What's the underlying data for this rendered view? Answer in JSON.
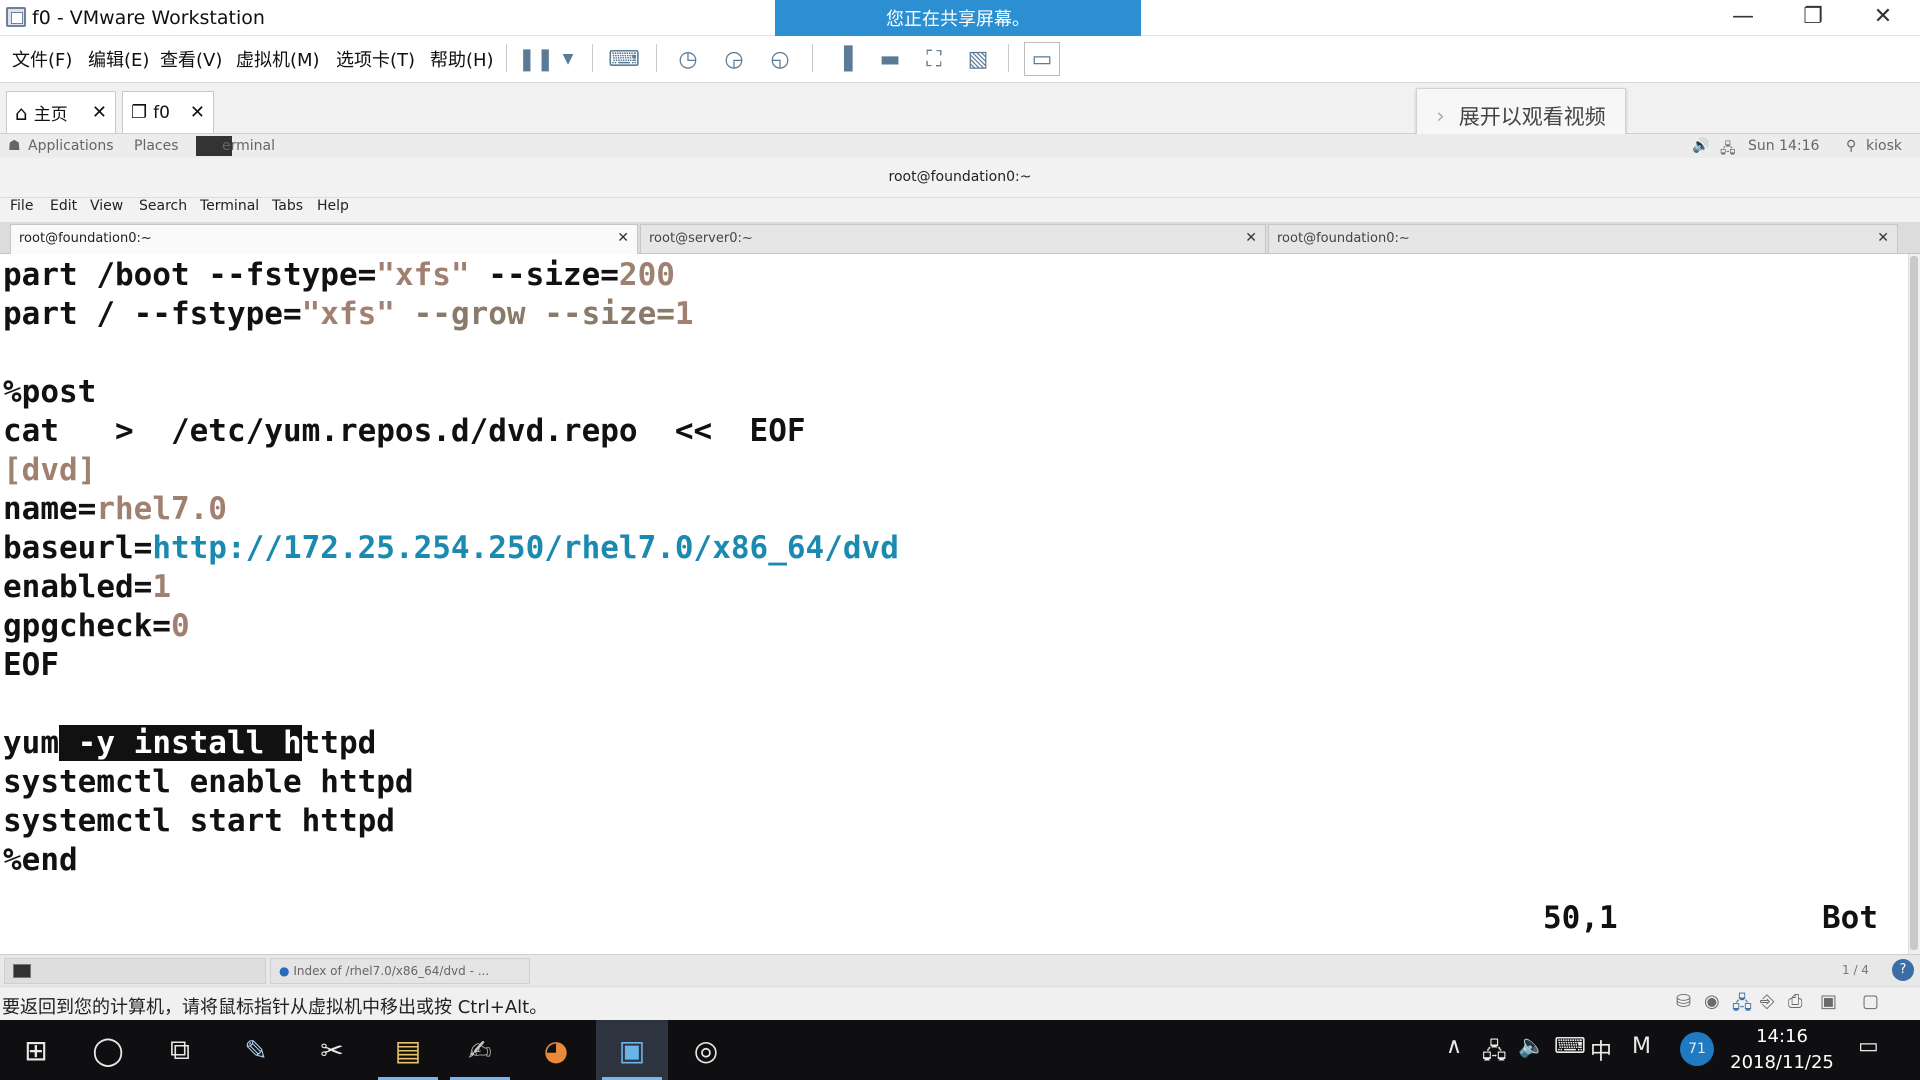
{
  "window": {
    "title": "f0 - VMware Workstation"
  },
  "share_banner": "您正在共享屏幕。",
  "menu": [
    "文件(F)",
    "编辑(E)",
    "查看(V)",
    "虚拟机(M)",
    "选项卡(T)",
    "帮助(H)"
  ],
  "toolbar_icons": [
    "pause-icon",
    "dropdown-icon",
    "send-keys-icon",
    "snapshot-icon",
    "revert-snapshot-icon",
    "snapshot-manager-icon",
    "sidebar-icon",
    "thumbnail-icon",
    "fullscreen-icon",
    "unity-icon",
    "console-icon"
  ],
  "vm_tabs": [
    {
      "label": "主页"
    },
    {
      "label": "f0"
    }
  ],
  "overlay": "展开以观看视频",
  "gnome": {
    "applications": "Applications",
    "places": "Places",
    "terminal_label": "erminal",
    "time": "Sun 14:16",
    "user": "kiosk"
  },
  "terminal": {
    "title": "root@foundation0:~",
    "menu": [
      "File",
      "Edit",
      "View",
      "Search",
      "Terminal",
      "Tabs",
      "Help"
    ],
    "tabs": [
      "root@foundation0:~",
      "root@server0:~",
      "root@foundation0:~"
    ],
    "lines": {
      "l1a": "part /boot --fstype=",
      "l1b": "\"xfs\"",
      "l1c": " --size=",
      "l1d": "200",
      "l2a": "part / --fstype=",
      "l2b": "\"xfs\"",
      "l2c": " --grow --size=",
      "l2d": "1",
      "l4": "%post",
      "l5": "cat   >  /etc/yum.repos.d/dvd.repo  <<  EOF",
      "l6": "[dvd]",
      "l7a": "name=",
      "l7b": "rhel7.0",
      "l8a": "baseurl=",
      "l8b": "http://172.25.254.250/rhel7.0/x86_64/dvd",
      "l9a": "enabled=",
      "l9b": "1",
      "l10a": "gpgcheck=",
      "l10b": "0",
      "l11": "EOF",
      "l13a": "yum",
      "l13b": " -y install h",
      "l13c": "ttpd",
      "l14": "systemctl enable httpd",
      "l15": "systemctl start httpd",
      "l16": "%end",
      "pos": "50,1",
      "scroll": "Bot"
    }
  },
  "gnome_taskbar": {
    "item2": "Index of /rhel7.0/x86_64/dvd - ...",
    "pager": "1 / 4"
  },
  "status_text": "要返回到您的计算机，请将鼠标指针从虚拟机中移出或按 Ctrl+Alt。",
  "win_taskbar": {
    "ime": "中",
    "badge": "71",
    "time": "14:16",
    "date": "2018/11/25"
  }
}
